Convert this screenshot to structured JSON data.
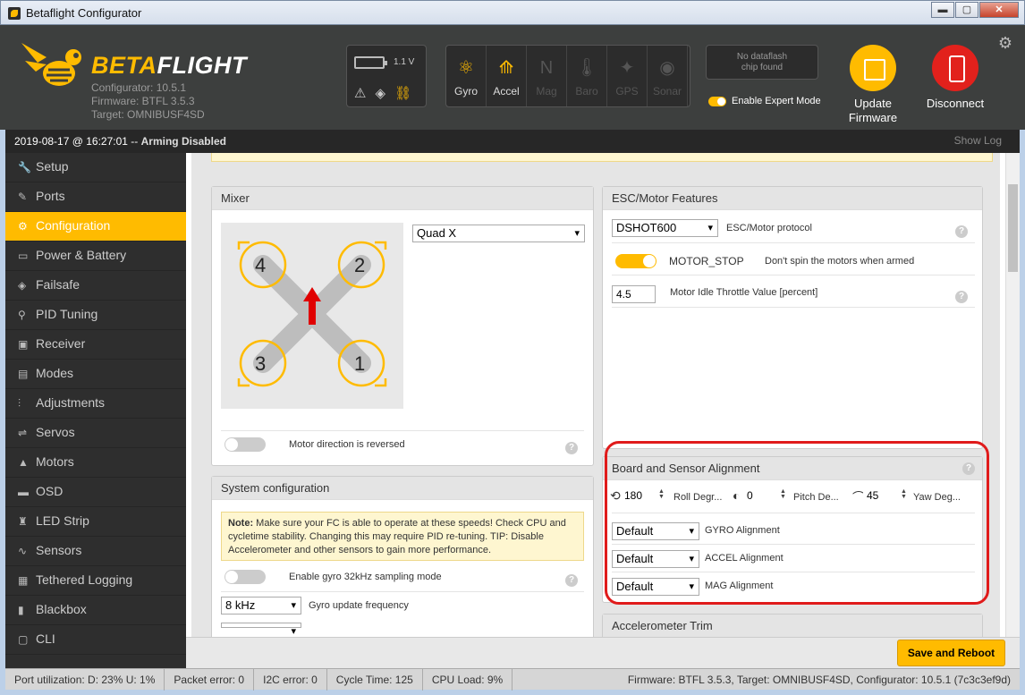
{
  "window": {
    "title": "Betaflight Configurator",
    "min": "▬",
    "max": "▢",
    "close": "✕"
  },
  "header": {
    "brand_beta": "BETA",
    "brand_flight": "FLIGHT",
    "configurator": "Configurator: 10.5.1",
    "firmware": "Firmware: BTFL 3.5.3",
    "target": "Target: OMNIBUSF4SD",
    "battery_voltage": "1.1 V",
    "sensors": [
      {
        "label": "Gyro",
        "icon": "⚛",
        "on": true
      },
      {
        "label": "Accel",
        "icon": "⟰",
        "on": true
      },
      {
        "label": "Mag",
        "icon": "N",
        "on": false
      },
      {
        "label": "Baro",
        "icon": "🌡",
        "on": false
      },
      {
        "label": "GPS",
        "icon": "✦",
        "on": false
      },
      {
        "label": "Sonar",
        "icon": "◉",
        "on": false
      }
    ],
    "dataflash_line1": "No dataflash",
    "dataflash_line2": "chip found",
    "expert_mode": "Enable Expert Mode",
    "update_firmware_1": "Update",
    "update_firmware_2": "Firmware",
    "disconnect": "Disconnect"
  },
  "status_top": {
    "datetime": "2019-08-17 @ 16:27:01 -- ",
    "state": "Arming Disabled",
    "show_log": "Show Log"
  },
  "sidebar": {
    "items": [
      {
        "label": "Setup",
        "icon": "🔧"
      },
      {
        "label": "Ports",
        "icon": "✎"
      },
      {
        "label": "Configuration",
        "icon": "⚙"
      },
      {
        "label": "Power & Battery",
        "icon": "▭"
      },
      {
        "label": "Failsafe",
        "icon": "◈"
      },
      {
        "label": "PID Tuning",
        "icon": "⚲"
      },
      {
        "label": "Receiver",
        "icon": "▣"
      },
      {
        "label": "Modes",
        "icon": "▤"
      },
      {
        "label": "Adjustments",
        "icon": "⫶"
      },
      {
        "label": "Servos",
        "icon": "⇌"
      },
      {
        "label": "Motors",
        "icon": "▲"
      },
      {
        "label": "OSD",
        "icon": "▬"
      },
      {
        "label": "LED Strip",
        "icon": "♜"
      },
      {
        "label": "Sensors",
        "icon": "∿"
      },
      {
        "label": "Tethered Logging",
        "icon": "▦"
      },
      {
        "label": "Blackbox",
        "icon": "▮"
      },
      {
        "label": "CLI",
        "icon": "▢"
      }
    ]
  },
  "mixer": {
    "title": "Mixer",
    "type": "Quad X",
    "motors": [
      "4",
      "2",
      "3",
      "1"
    ],
    "reversed_label": "Motor direction is reversed",
    "reversed": false
  },
  "system": {
    "title": "System configuration",
    "note_bold": "Note:",
    "note_text": " Make sure your FC is able to operate at these speeds! Check CPU and cycletime stability. Changing this may require PID re-tuning. TIP: Disable Accelerometer and other sensors to gain more performance.",
    "gyro32_label": "Enable gyro 32kHz sampling mode",
    "gyro_freq": "8 kHz",
    "gyro_freq_label": "Gyro update frequency"
  },
  "esc": {
    "title": "ESC/Motor Features",
    "protocol": "DSHOT600",
    "protocol_label": "ESC/Motor protocol",
    "motor_stop": "MOTOR_STOP",
    "motor_stop_desc": "Don't spin the motors when armed",
    "idle_value": "4.5",
    "idle_label": "Motor Idle Throttle Value [percent]"
  },
  "alignment": {
    "title": "Board and Sensor Alignment",
    "roll": "180",
    "roll_label": "Roll Degr...",
    "pitch": "0",
    "pitch_label": "Pitch De...",
    "yaw": "45",
    "yaw_label": "Yaw Deg...",
    "gyro": "Default",
    "gyro_label": "GYRO Alignment",
    "accel": "Default",
    "accel_label": "ACCEL Alignment",
    "mag": "Default",
    "mag_label": "MAG Alignment"
  },
  "accel_trim": {
    "title": "Accelerometer Trim"
  },
  "save_reboot": "Save and Reboot",
  "bottom": {
    "port": "Port utilization: D: 23% U: 1%",
    "packet": "Packet error: 0",
    "i2c": "I2C error: 0",
    "cycle": "Cycle Time: 125",
    "cpu": "CPU Load: 9%",
    "fw": "Firmware: BTFL 3.5.3, Target: OMNIBUSF4SD, Configurator: 10.5.1 (7c3c3ef9d)"
  },
  "colors": {
    "accent": "#ffbb00",
    "header": "#3d3f3e",
    "sidebar": "#2e2e2e",
    "highlight": "#e01b1b"
  }
}
